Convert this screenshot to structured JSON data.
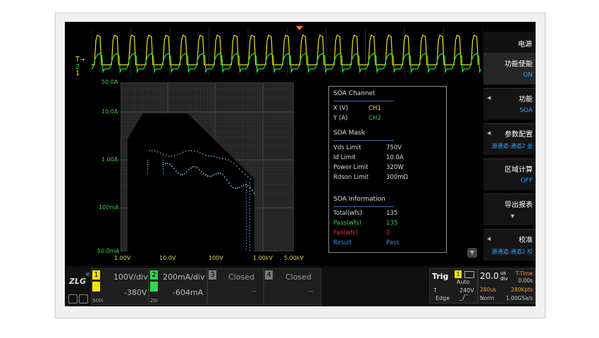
{
  "menu": {
    "title": "电源",
    "items": [
      {
        "label": "功能使能",
        "value": "ON"
      },
      {
        "label": "功能",
        "value": "SOA"
      },
      {
        "label": "参数配置",
        "value": "源通道:通道2 坐"
      },
      {
        "label": "区域计算",
        "value": "OFF"
      },
      {
        "label": "导出报表",
        "value": ""
      },
      {
        "label": "校准",
        "value": "源通道:通道2 校"
      }
    ]
  },
  "wave_labels": {
    "trigger": "T",
    "ch2": "2",
    "ch1": "1"
  },
  "plot": {
    "y_ticks": [
      "50.0A",
      "10.0A",
      "1.00A",
      "100mA",
      "10.0mA"
    ],
    "x_ticks": [
      "1.00V",
      "10.0V",
      "100V",
      "1.00kV",
      "5.00kV"
    ]
  },
  "info": {
    "soa_channel_title": "SOA Channel",
    "x_label": "X (V)",
    "x_value": "CH1",
    "y_label": "Y (A)",
    "y_value": "CH2",
    "soa_mask_title": "SOA Mask",
    "vds_label": "Vds Limit",
    "vds_value": "750V",
    "id_label": "Id  Limit",
    "id_value": "10.0A",
    "power_label": "Power Limit",
    "power_value": "320W",
    "rdson_label": "Rdson Limit",
    "rdson_value": "300mΩ",
    "soa_info_title": "SOA Information",
    "total_label": "Total(wfs)",
    "total_value": "135",
    "pass_label": "Pass(wfs)",
    "pass_value": "135",
    "fail_label": "Fail(wfs)",
    "fail_value": "0",
    "result_label": "Result",
    "result_value": "Pass"
  },
  "colors": {
    "ch1": "#f2e600",
    "ch2": "#2fd64a",
    "ch3": "#b0b0b0",
    "ch4": "#b0b0b0",
    "blue": "#3a8de0",
    "red": "#e0303a"
  },
  "bottom": {
    "logo": "ZLG",
    "ch1": {
      "num": "1",
      "scale": "100V/div",
      "offset": "-380V",
      "tag": "500i"
    },
    "ch2": {
      "num": "2",
      "scale": "200mA/div",
      "offset": "-604mA",
      "tag": "20i"
    },
    "ch3": {
      "num": "3",
      "scale": "Closed",
      "offset": "--"
    },
    "ch4": {
      "num": "4",
      "scale": "Closed",
      "offset": "--"
    },
    "trig": {
      "title": "Trig",
      "src": "1",
      "mode": "Auto",
      "t": "T",
      "level": "240V",
      "type": "Edge"
    },
    "time": {
      "div": "20.0",
      "unit_top": "us",
      "unit_bot": "div",
      "label": "T-Time",
      "ttime": "0.00s",
      "mem": "280us",
      "rate_pts": "280Kpts",
      "norm": "Norm",
      "rate": "1.00GSa/s"
    }
  }
}
